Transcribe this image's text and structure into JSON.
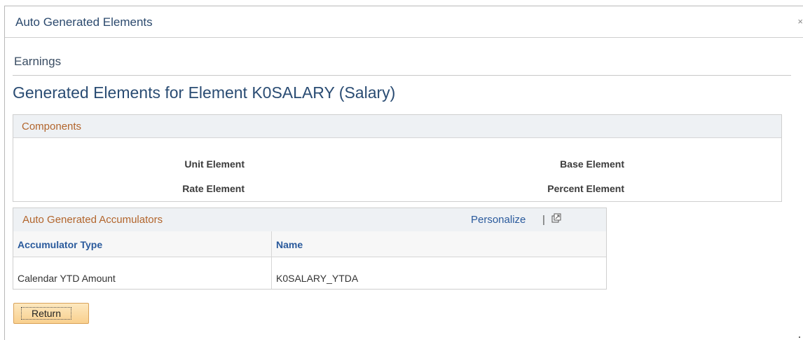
{
  "modal": {
    "title": "Auto Generated Elements",
    "close_glyph": "×"
  },
  "page": {
    "subtitle": "Earnings",
    "title": "Generated Elements for Element K0SALARY (Salary)"
  },
  "components": {
    "header": "Components",
    "labels": {
      "unit": "Unit Element",
      "base": "Base Element",
      "rate": "Rate Element",
      "percent": "Percent Element"
    }
  },
  "accumulators": {
    "header": "Auto Generated Accumulators",
    "personalize": "Personalize",
    "separator": "|",
    "popout_icon": "new-window-icon",
    "columns": [
      "Accumulator Type",
      "Name"
    ],
    "rows": [
      [
        "Calendar YTD Amount",
        "K0SALARY_YTDA"
      ]
    ]
  },
  "actions": {
    "return_label": "Return"
  },
  "colors": {
    "header_text": "#2c4a6e",
    "group_title": "#b2652c",
    "link": "#2a5a9c",
    "button_bg": "#f9d08e"
  }
}
